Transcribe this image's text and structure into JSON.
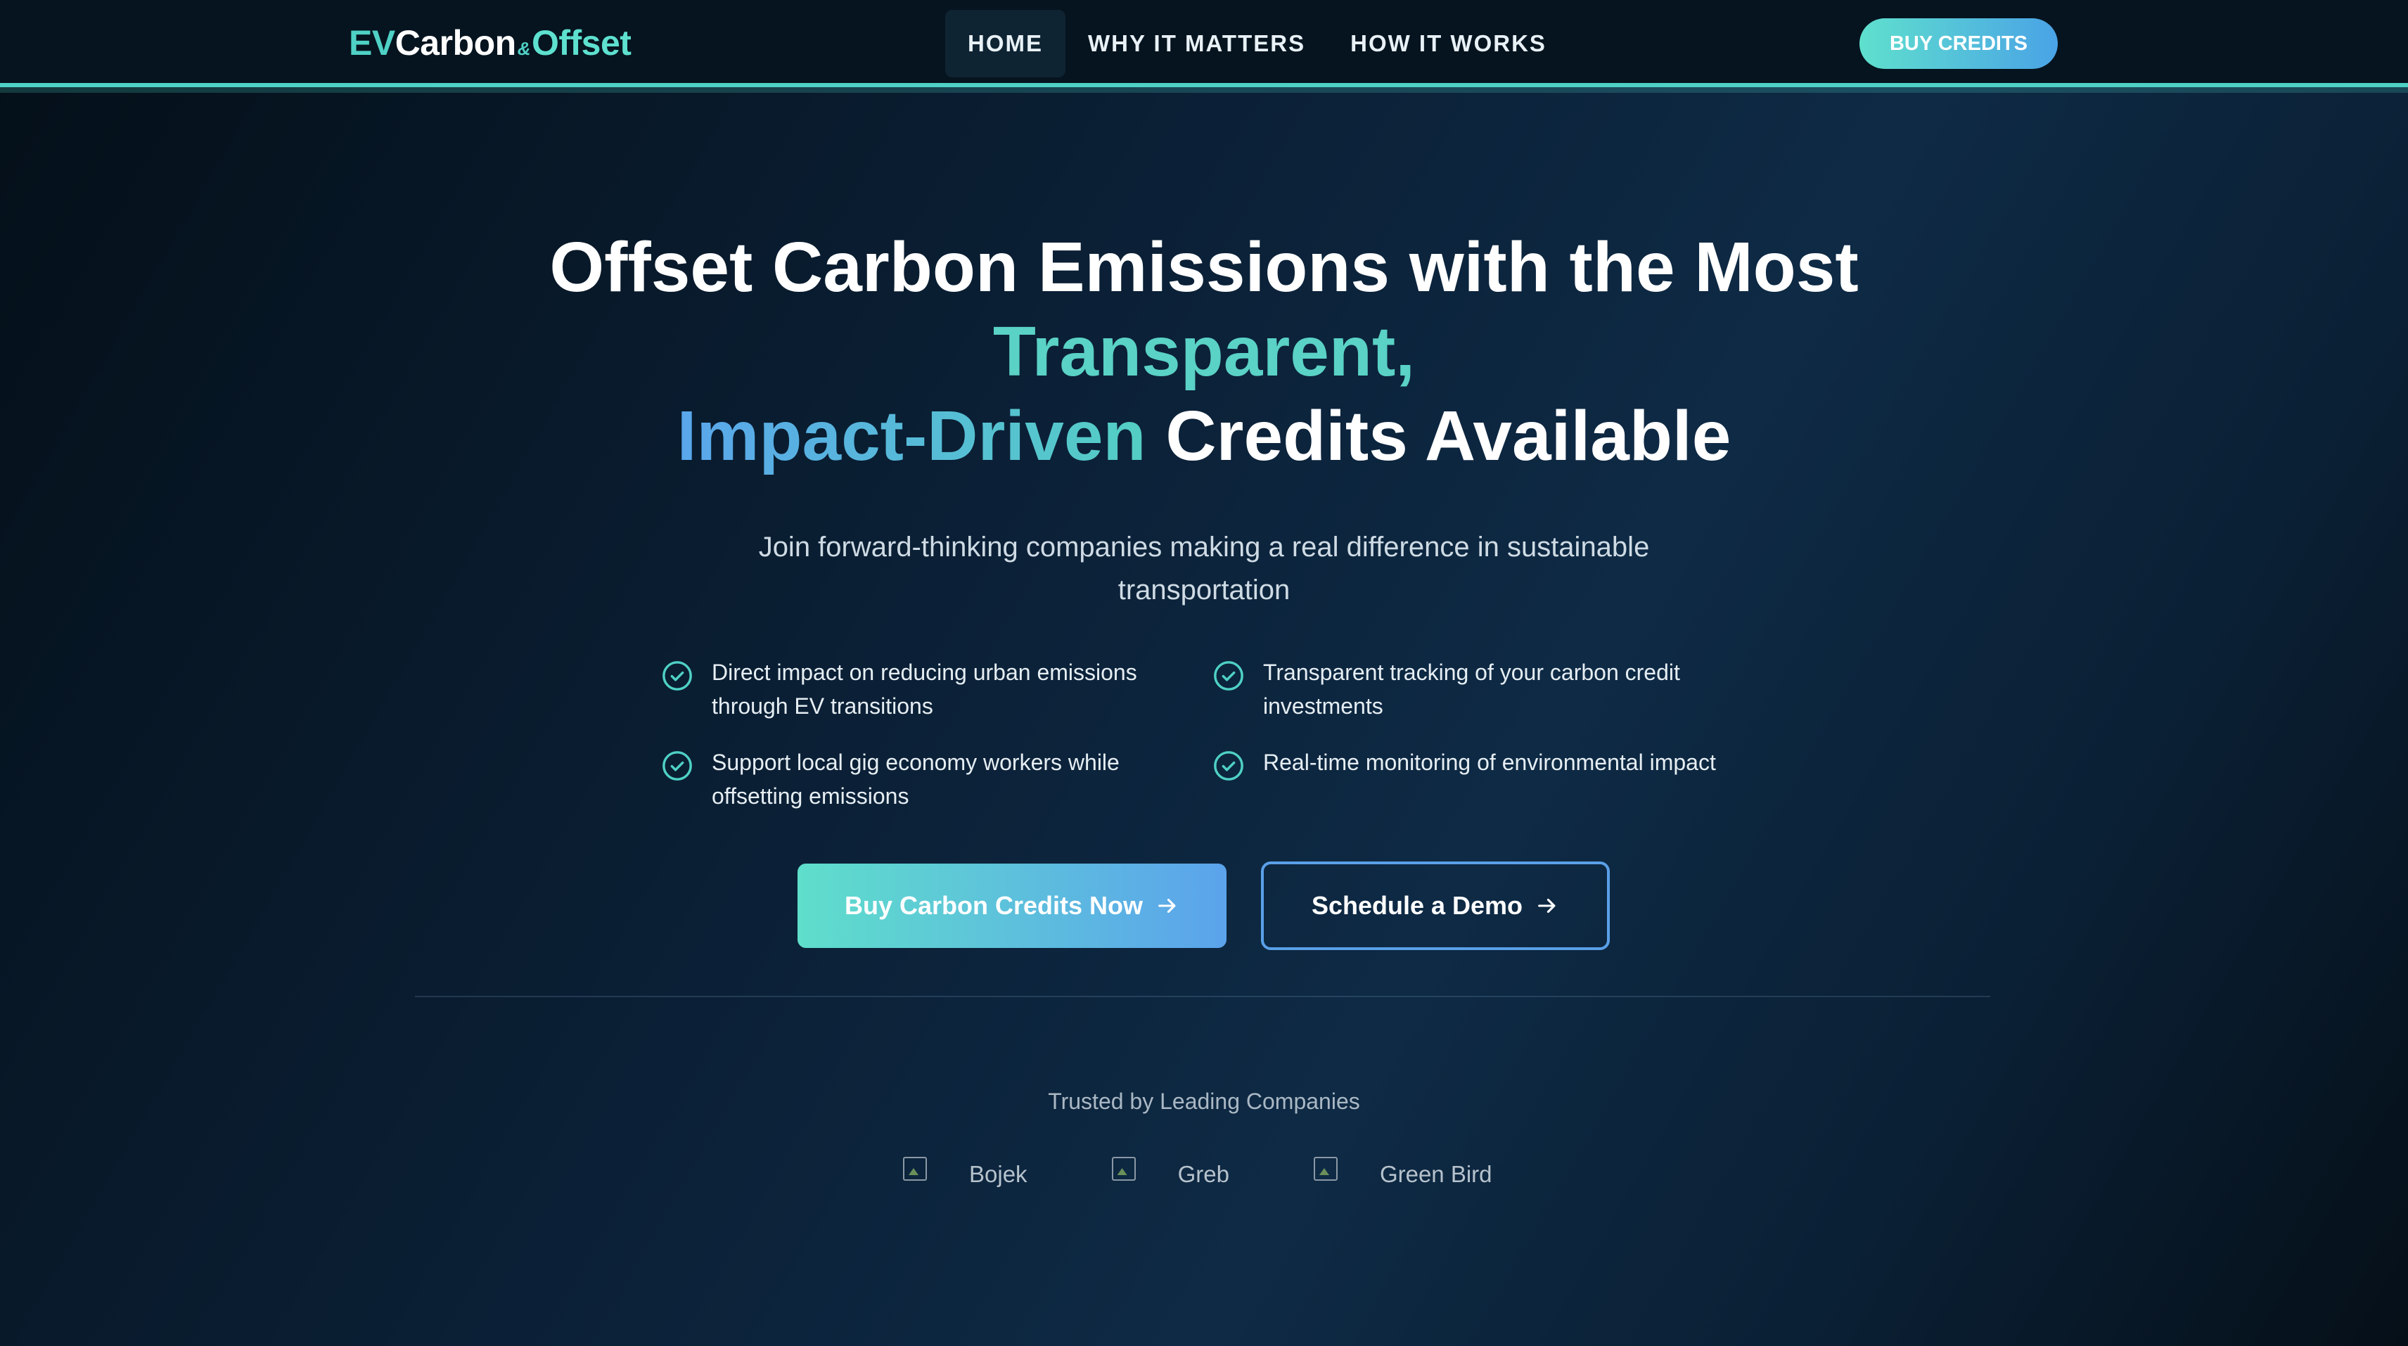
{
  "nav": {
    "logo": {
      "ev": "EV",
      "carbon": "Carbon",
      "amp": "&",
      "offset": "Offset"
    },
    "links": [
      {
        "label": "HOME",
        "active": true
      },
      {
        "label": "WHY IT MATTERS",
        "active": false
      },
      {
        "label": "HOW IT WORKS",
        "active": false
      }
    ],
    "cta_label": "BUY CREDITS"
  },
  "hero": {
    "title_line1": "Offset Carbon Emissions with the Most",
    "title_highlight1": "Transparent,",
    "title_highlight2": "Impact-Driven",
    "title_line3_rest": " Credits Available",
    "subtitle": "Join forward-thinking companies making a real difference in sustainable transportation",
    "features": [
      {
        "icon": "check-circle-icon",
        "text": "Direct impact on reducing urban emissions through EV transitions"
      },
      {
        "icon": "check-circle-icon",
        "text": "Transparent tracking of your carbon credit investments"
      },
      {
        "icon": "check-circle-icon",
        "text": "Support local gig economy workers while offsetting emissions"
      },
      {
        "icon": "check-circle-icon",
        "text": "Real-time monitoring of environmental impact"
      }
    ],
    "primary_cta": "Buy Carbon Credits Now",
    "secondary_cta": "Schedule a Demo"
  },
  "trusted": {
    "heading": "Trusted by Leading Companies",
    "companies": [
      "Bojek",
      "Greb",
      "Green Bird"
    ]
  },
  "colors": {
    "accent_teal": "#4fd1c5",
    "accent_blue": "#5aa0e8",
    "background": "#0b2036"
  }
}
